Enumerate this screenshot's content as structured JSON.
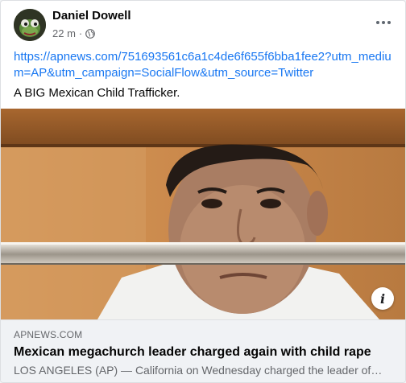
{
  "post": {
    "author": "Daniel Dowell",
    "time": "22 m",
    "separator": "·",
    "audience_icon": "globe-icon",
    "link_url": "https://apnews.com/751693561c6a1c4de6f655f6bba1fee2?utm_medium=AP&utm_campaign=SocialFlow&utm_source=Twitter",
    "text": "A BIG Mexican Child Trafficker."
  },
  "preview": {
    "domain": "APNEWS.COM",
    "title": "Mexican megachurch leader charged again with child rape",
    "description": "LOS ANGELES (AP) — California on Wednesday charged the leader of a Mexican megachurch with child rape"
  },
  "colors": {
    "link": "#1877f2",
    "text": "#050505",
    "secondary": "#65676b",
    "preview_bg": "#f0f2f5"
  }
}
